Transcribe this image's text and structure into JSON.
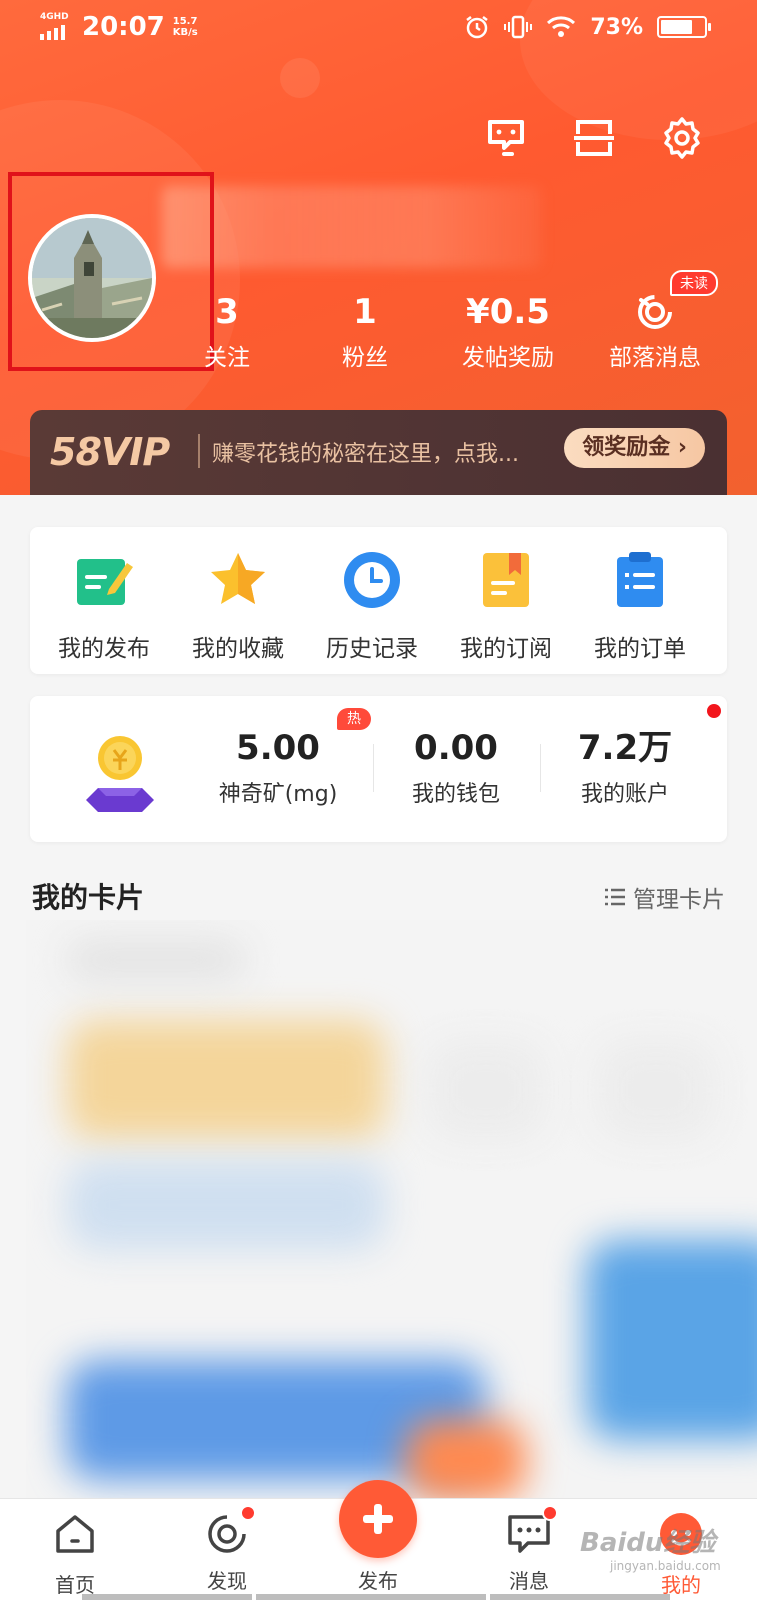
{
  "statusbar": {
    "network": "4GHD",
    "time": "20:07",
    "speed_value": "15.7",
    "speed_unit": "KB/s",
    "battery": "73%",
    "battery_level": 0.73
  },
  "profile": {
    "stats": [
      {
        "num": "3",
        "label": "关注"
      },
      {
        "num": "1",
        "label": "粉丝"
      },
      {
        "num": "¥0.5",
        "label": "发帖奖励"
      },
      {
        "num": "",
        "label": "部落消息"
      }
    ],
    "unread_badge": "未读"
  },
  "vip": {
    "logo": "58VIP",
    "text": "赚零花钱的秘密在这里，点我...",
    "button": "领奖励金 ›"
  },
  "quick_actions": [
    {
      "label": "我的发布",
      "icon": "post-edit-icon"
    },
    {
      "label": "我的收藏",
      "icon": "star-icon"
    },
    {
      "label": "历史记录",
      "icon": "clock-icon"
    },
    {
      "label": "我的订阅",
      "icon": "subscribe-book-icon"
    },
    {
      "label": "我的订单",
      "icon": "order-clipboard-icon"
    }
  ],
  "wallet": {
    "hot_badge": "热",
    "items": [
      {
        "num": "5.00",
        "label": "神奇矿(mg)"
      },
      {
        "num": "0.00",
        "label": "我的钱包"
      },
      {
        "num": "7.2万",
        "label": "我的账户"
      }
    ]
  },
  "cards_section": {
    "title": "我的卡片",
    "manage": "管理卡片"
  },
  "tabbar": {
    "tabs": [
      {
        "label": "首页",
        "icon": "home-icon"
      },
      {
        "label": "发现",
        "icon": "discover-icon"
      },
      {
        "label": "发布",
        "icon": "plus-icon"
      },
      {
        "label": "消息",
        "icon": "message-icon"
      },
      {
        "label": "我的",
        "icon": "profile-icon"
      }
    ]
  },
  "watermark": {
    "text": "Baidu经验",
    "sub": "jingyan.baidu.com"
  },
  "colors": {
    "accent": "#ff5a36",
    "header": "#ff6a3d",
    "vip_bg": "#5a3a36",
    "badge_red": "#ff3b2f"
  }
}
